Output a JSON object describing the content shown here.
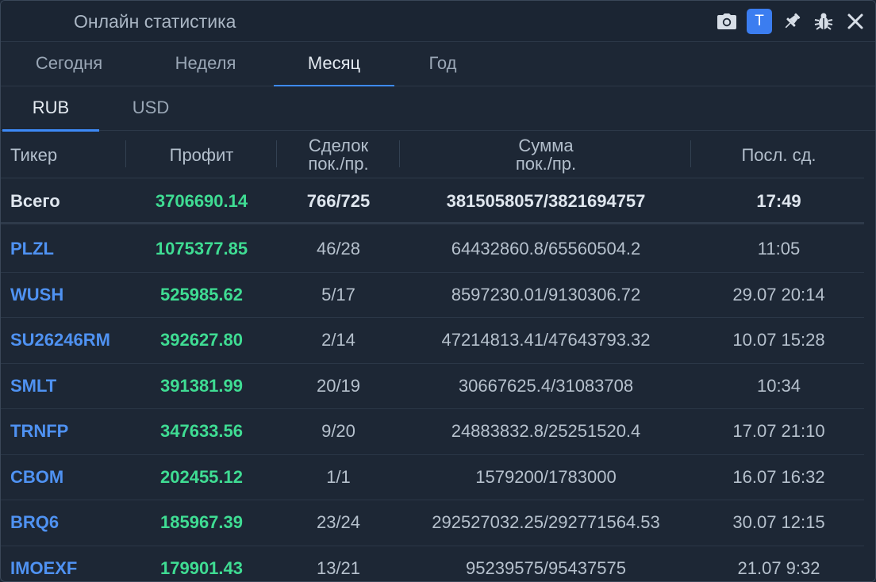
{
  "window": {
    "title": "Онлайн статистика"
  },
  "toolbar": {
    "t_label": "T"
  },
  "tabs": [
    {
      "label": "Сегодня"
    },
    {
      "label": "Неделя"
    },
    {
      "label": "Месяц"
    },
    {
      "label": "Год"
    }
  ],
  "active_tab": "Месяц",
  "currency_tabs": [
    {
      "label": "RUB"
    },
    {
      "label": "USD"
    }
  ],
  "active_currency": "RUB",
  "columns": {
    "ticker": "Тикер",
    "profit": "Профит",
    "deals_line1": "Сделок",
    "deals_line2": "пок./пр.",
    "sum_line1": "Сумма",
    "sum_line2": "пок./пр.",
    "last": "Посл. сд."
  },
  "total": {
    "label": "Всего",
    "profit": "3706690.14",
    "deals": "766/725",
    "sum": "3815058057/3821694757",
    "last": "17:49"
  },
  "rows": [
    {
      "ticker": "PLZL",
      "profit": "1075377.85",
      "deals": "46/28",
      "sum": "64432860.8/65560504.2",
      "last": "11:05"
    },
    {
      "ticker": "WUSH",
      "profit": "525985.62",
      "deals": "5/17",
      "sum": "8597230.01/9130306.72",
      "last": "29.07 20:14"
    },
    {
      "ticker": "SU26246RM",
      "profit": "392627.80",
      "deals": "2/14",
      "sum": "47214813.41/47643793.32",
      "last": "10.07 15:28"
    },
    {
      "ticker": "SMLT",
      "profit": "391381.99",
      "deals": "20/19",
      "sum": "30667625.4/31083708",
      "last": "10:34"
    },
    {
      "ticker": "TRNFP",
      "profit": "347633.56",
      "deals": "9/20",
      "sum": "24883832.8/25251520.4",
      "last": "17.07 21:10"
    },
    {
      "ticker": "CBOM",
      "profit": "202455.12",
      "deals": "1/1",
      "sum": "1579200/1783000",
      "last": "16.07 16:32"
    },
    {
      "ticker": "BRQ6",
      "profit": "185967.39",
      "deals": "23/24",
      "sum": "292527032.25/292771564.53",
      "last": "30.07 12:15"
    },
    {
      "ticker": "IMOEXF",
      "profit": "179901.43",
      "deals": "13/21",
      "sum": "95239575/95437575",
      "last": "21.07 9:32"
    }
  ],
  "colors": {
    "background": "#1d2735",
    "accent": "#3d8af7",
    "profit": "#3fdc93",
    "ticker": "#4f92f2"
  },
  "icons": [
    "camera-icon",
    "pin-icon",
    "bug-icon",
    "close-icon"
  ]
}
